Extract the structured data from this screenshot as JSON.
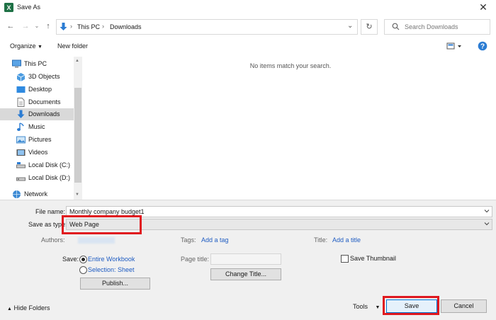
{
  "window": {
    "title": "Save As"
  },
  "address": {
    "crumbs": [
      "This PC",
      "Downloads"
    ]
  },
  "search": {
    "placeholder": "Search Downloads"
  },
  "toolbar": {
    "organize": "Organize",
    "new_folder": "New folder"
  },
  "sidebar": {
    "items": [
      {
        "label": "This PC",
        "icon": "pc-icon",
        "level": "top"
      },
      {
        "label": "3D Objects",
        "icon": "3d-objects-icon",
        "level": "child"
      },
      {
        "label": "Desktop",
        "icon": "desktop-icon",
        "level": "child"
      },
      {
        "label": "Documents",
        "icon": "documents-icon",
        "level": "child"
      },
      {
        "label": "Downloads",
        "icon": "downloads-icon",
        "level": "child",
        "selected": true
      },
      {
        "label": "Music",
        "icon": "music-icon",
        "level": "child"
      },
      {
        "label": "Pictures",
        "icon": "pictures-icon",
        "level": "child"
      },
      {
        "label": "Videos",
        "icon": "videos-icon",
        "level": "child"
      },
      {
        "label": "Local Disk (C:)",
        "icon": "disk-icon",
        "level": "child"
      },
      {
        "label": "Local Disk (D:)",
        "icon": "disk-icon",
        "level": "child"
      },
      {
        "label": "Network",
        "icon": "network-icon",
        "level": "top"
      }
    ]
  },
  "main": {
    "empty_message": "No items match your search."
  },
  "form": {
    "file_name_label": "File name:",
    "file_name_value": "Monthly company budget1",
    "save_as_type_label": "Save as type:",
    "save_as_type_value": "Web Page",
    "authors_label": "Authors:",
    "tags_label": "Tags:",
    "add_tag": "Add a tag",
    "title_label": "Title:",
    "add_title": "Add a title",
    "save_label": "Save:",
    "entire_workbook": "Entire Workbook",
    "selection_sheet": "Selection: Sheet",
    "publish": "Publish...",
    "page_title_label": "Page title:",
    "change_title": "Change Title...",
    "save_thumbnail": "Save Thumbnail"
  },
  "footer": {
    "hide_folders": "Hide Folders",
    "tools": "Tools",
    "save_button": "Save",
    "cancel_button": "Cancel"
  },
  "colors": {
    "highlight_red": "#e0191f",
    "link_blue": "#1f5cc2",
    "folder_blue": "#2b7cd3"
  }
}
